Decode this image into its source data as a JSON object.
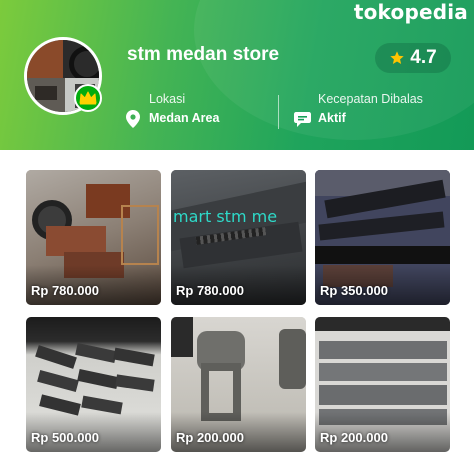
{
  "brand": "tokopedia",
  "store": {
    "name": "stm medan store",
    "rating": "4.7",
    "location_label": "Lokasi",
    "location_value": "Medan Area",
    "speed_label": "Kecepatan Dibalas",
    "speed_value": "Aktif"
  },
  "icons": {
    "star": "star-icon",
    "location": "location-pin-icon",
    "chat": "chat-bubble-icon",
    "badge": "crown-badge-icon"
  },
  "colors": {
    "accent": "#03ac0e",
    "star": "#ffc400"
  },
  "products": [
    {
      "price": "Rp 780.000",
      "watermark": ""
    },
    {
      "price": "Rp 780.000",
      "watermark": "mart stm me"
    },
    {
      "price": "Rp 350.000",
      "watermark": ""
    },
    {
      "price": "Rp 500.000",
      "watermark": ""
    },
    {
      "price": "Rp 200.000",
      "watermark": ""
    },
    {
      "price": "Rp 200.000",
      "watermark": ""
    }
  ]
}
